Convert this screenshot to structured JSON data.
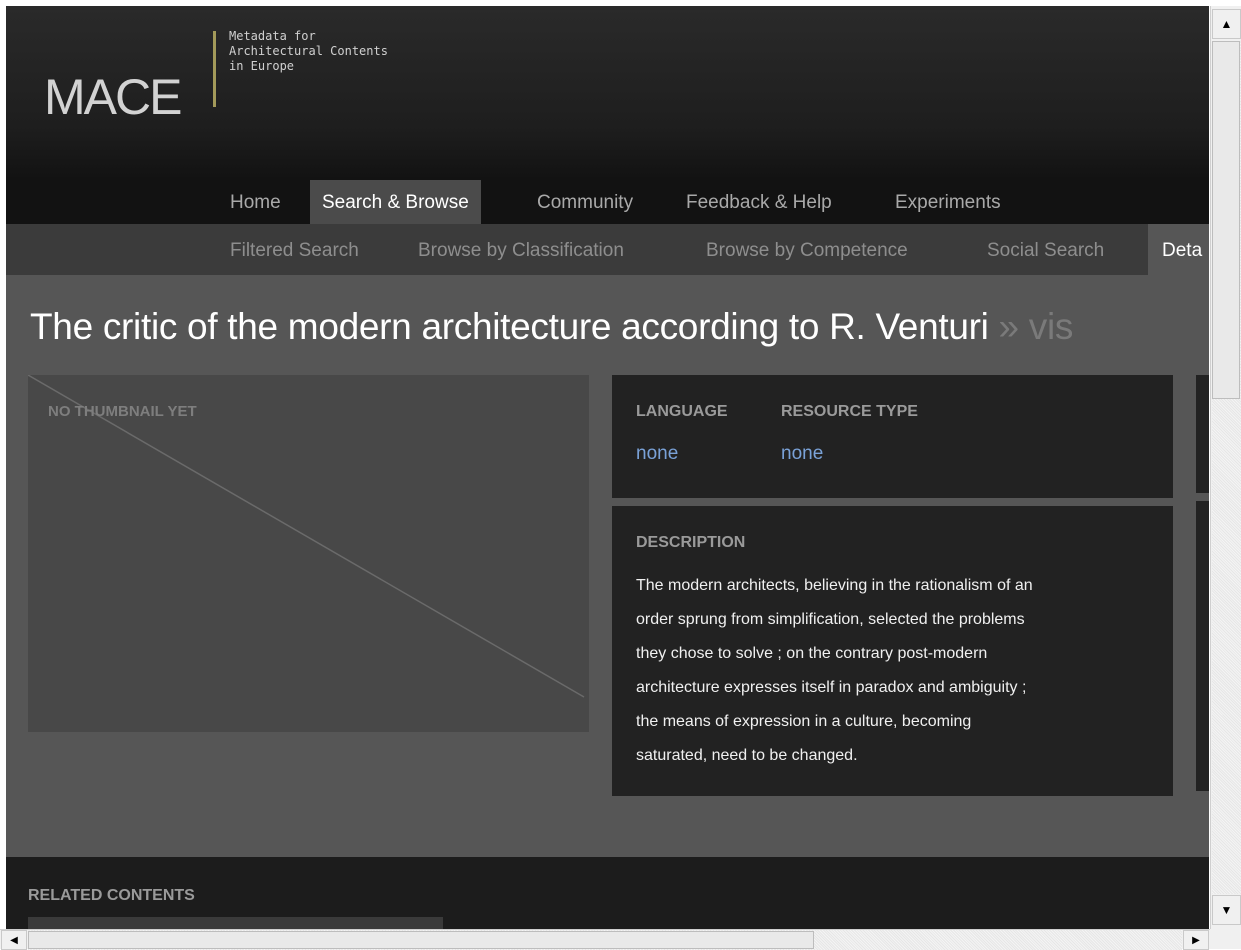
{
  "logo": {
    "name": "MACE",
    "tagline": [
      "Metadata for",
      "Architectural Contents",
      "in Europe"
    ],
    "accent_color": "#a39a5a"
  },
  "main_nav": {
    "items": [
      {
        "label": "Home"
      },
      {
        "label": "Search & Browse",
        "active": true
      },
      {
        "label": "Community"
      },
      {
        "label": "Feedback & Help"
      },
      {
        "label": "Experiments"
      }
    ]
  },
  "sub_nav": {
    "items": [
      {
        "label": "Filtered Search"
      },
      {
        "label": "Browse by Classification"
      },
      {
        "label": "Browse by Competence"
      },
      {
        "label": "Social Search"
      },
      {
        "label": "Deta",
        "active": true
      }
    ]
  },
  "page": {
    "title": "The critic of the modern architecture according to R. Venturi",
    "title_suffix": "» vis"
  },
  "thumbnail": {
    "label": "NO THUMBNAIL YET"
  },
  "metadata": {
    "language_label": "LANGUAGE",
    "language_value": "none",
    "resource_type_label": "RESOURCE TYPE",
    "resource_type_value": "none",
    "link_color": "#7aa2d8"
  },
  "description": {
    "label": "DESCRIPTION",
    "lines": [
      "The modern architects, believing in the rationalism of an",
      "order sprung from simplification, selected the problems",
      "they chose to solve ; on the contrary post-modern",
      "architecture expresses itself in paradox and ambiguity ;",
      "the means of expression in a culture, becoming",
      "saturated, need to be changed."
    ]
  },
  "related": {
    "label": "RELATED CONTENTS"
  },
  "scrollbars": {
    "up_icon": "arrow-up-icon",
    "down_icon": "arrow-down-icon",
    "left_icon": "arrow-left-icon",
    "right_icon": "arrow-right-icon"
  }
}
